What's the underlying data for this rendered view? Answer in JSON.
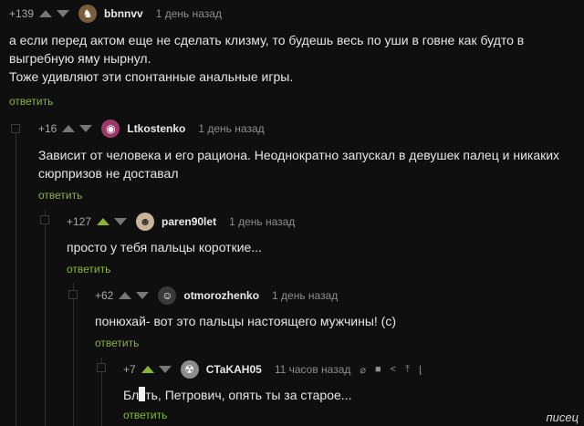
{
  "comments": [
    {
      "rating": "+139",
      "username": "bbnnvv",
      "time": "1 день назад",
      "lines": [
        "а если перед актом еще не сделать клизму, то будешь весь по уши в говне как будто в",
        "выгребную яму нырнул.",
        "Тоже удивляют эти спонтанные анальные игры."
      ],
      "reply": "ответить",
      "up_active": false
    },
    {
      "rating": "+16",
      "username": "Ltkostenko",
      "time": "1 день назад",
      "lines": [
        "Зависит от человека и его рациона. Неоднократно запускал в девушек палец и никаких",
        "сюрпризов не доставал"
      ],
      "reply": "ответить",
      "up_active": false
    },
    {
      "rating": "+127",
      "username": "paren90let",
      "time": "1 день назад",
      "lines": [
        "просто у тебя пальцы короткие..."
      ],
      "reply": "ответить",
      "up_active": true
    },
    {
      "rating": "+62",
      "username": "otmorozhenko",
      "time": "1 день назад",
      "lines": [
        "понюхай- вот это пальцы настоящего мужчины! (с)"
      ],
      "reply": "ответить",
      "up_active": false
    },
    {
      "rating": "+7",
      "username": "CTaKAH05",
      "time": "11 часов назад",
      "text_before": "Бл",
      "text_after": "ть, Петрович, опять ты за старое...",
      "reply": "ответить",
      "up_active": true,
      "actions": [
        "⌀",
        "■",
        "<",
        "⤒",
        "⌊"
      ]
    }
  ],
  "watermark": "писец",
  "colors": {
    "background": "#0f0f0f",
    "reply": "#8ab534",
    "meta": "#8d8d8d"
  },
  "icons": {
    "vote_up": "triangle-up-icon",
    "vote_down": "triangle-down-icon"
  }
}
